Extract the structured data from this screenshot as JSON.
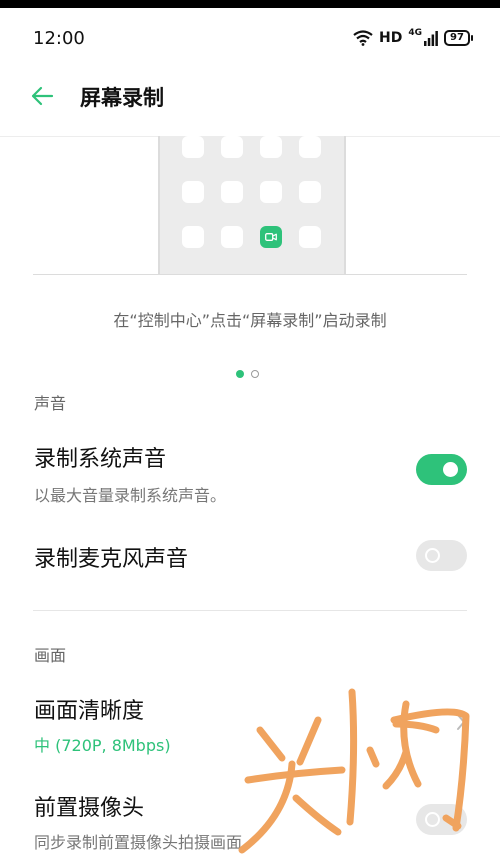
{
  "status_bar": {
    "time": "12:00",
    "hd": "HD",
    "network": "4G",
    "battery": "97",
    "icons": [
      "wifi-icon",
      "signal-icon",
      "battery-icon"
    ]
  },
  "header": {
    "title": "屏幕录制",
    "back_icon": "back-arrow-icon"
  },
  "preview": {
    "caption": "在“控制中心”点击“屏幕录制”启动录制",
    "page_indicator": {
      "current": 1,
      "total": 2
    }
  },
  "sound_section": {
    "label": "声音",
    "items": [
      {
        "title": "录制系统声音",
        "subtitle": "以最大音量录制系统声音。",
        "enabled": true
      },
      {
        "title": "录制麦克风声音",
        "enabled": false
      }
    ]
  },
  "video_section": {
    "label": "画面",
    "items": [
      {
        "title": "画面清晰度",
        "value": "中 (720P, 8Mbps)"
      },
      {
        "title": "前置摄像头",
        "subtitle": "同步录制前置摄像头拍摄画面。",
        "enabled": false
      }
    ]
  },
  "colors": {
    "accent": "#2ec27a",
    "handwriting": "#f0a35e"
  }
}
